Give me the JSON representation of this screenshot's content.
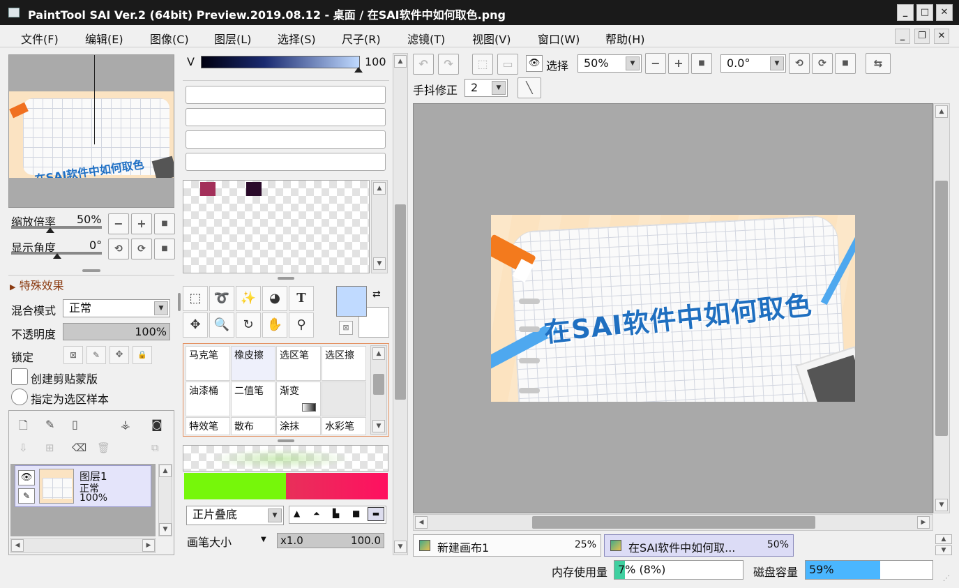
{
  "window": {
    "title": "PaintTool SAI Ver.2 (64bit) Preview.2019.08.12 - 桌面 / 在SAI软件中如何取色.png",
    "controls": [
      "_",
      "□",
      "✕"
    ]
  },
  "menu": [
    {
      "label": "文件(F)"
    },
    {
      "label": "编辑(E)"
    },
    {
      "label": "图像(C)"
    },
    {
      "label": "图层(L)"
    },
    {
      "label": "选择(S)"
    },
    {
      "label": "尺子(R)"
    },
    {
      "label": "滤镜(T)"
    },
    {
      "label": "视图(V)"
    },
    {
      "label": "窗口(W)"
    },
    {
      "label": "帮助(H)"
    }
  ],
  "navigator": {
    "thumbnail_text": "在SAI软件中如何取色",
    "zoom_label": "缩放倍率",
    "zoom_value": "50%",
    "angle_label": "显示角度",
    "angle_value": "0°",
    "special_effects": "特殊效果"
  },
  "layer_props": {
    "blend_label": "混合模式",
    "blend_value": "正常",
    "opacity_label": "不透明度",
    "opacity_value": "100%",
    "lock_label": "锁定",
    "clip_label": "创建剪贴蒙版",
    "sample_label": "指定为选区样本"
  },
  "layers": [
    {
      "name": "图层1",
      "mode": "正常",
      "opacity": "100%"
    }
  ],
  "color": {
    "v_label": "V",
    "v_value": "100",
    "swatches": [
      "#a3305a",
      "#2a0a2a"
    ],
    "fg_color": "#c0daff"
  },
  "brushes": [
    {
      "label": "马克笔"
    },
    {
      "label": "橡皮擦"
    },
    {
      "label": "选区笔"
    },
    {
      "label": "选区擦"
    },
    {
      "label": "油漆桶"
    },
    {
      "label": "二值笔"
    },
    {
      "label": "渐变"
    },
    {
      "label": ""
    },
    {
      "label": "特效笔"
    },
    {
      "label": "散布"
    },
    {
      "label": "涂抹"
    },
    {
      "label": "水彩笔"
    }
  ],
  "brush_settings": {
    "blend_value": "正片叠底",
    "size_label": "画笔大小",
    "size_mult": "x1.0",
    "size_value": "100.0",
    "bg_preview_green": "#76f70a",
    "bg_preview_red": "#ff1060"
  },
  "toolbar": {
    "select_label": "选择",
    "zoom_value": "50%",
    "angle_value": "0.0°",
    "stabilizer_label": "手抖修正",
    "stabilizer_value": "2"
  },
  "canvas": {
    "image_text": "在SAI软件中如何取色"
  },
  "tabs": [
    {
      "name": "新建画布1",
      "zoom": "25%"
    },
    {
      "name": "在SAI软件中如何取...",
      "zoom": "50%"
    }
  ],
  "status": {
    "mem_label": "内存使用量",
    "mem_value": "7% (8%)",
    "mem_fraction": 0.08,
    "disk_label": "磁盘容量",
    "disk_value": "59%",
    "disk_fraction": 0.59
  }
}
